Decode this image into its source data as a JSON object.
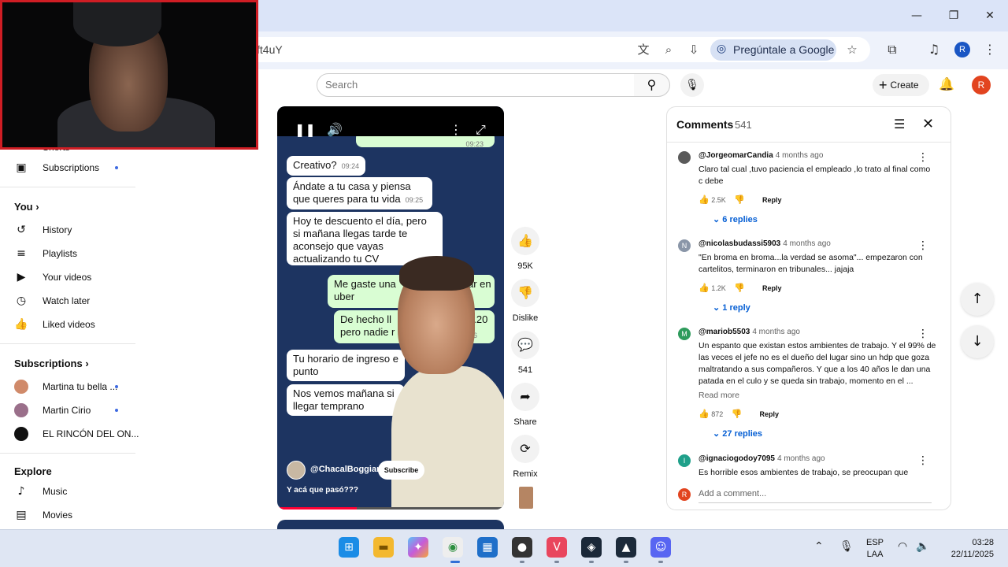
{
  "window": {
    "minimize": "—",
    "maximize": "❐",
    "close": "✕"
  },
  "browser": {
    "url_fragment": "ft4uY",
    "google_pill": "Pregúntale a Google",
    "profile_initial": "R"
  },
  "youtube": {
    "search_placeholder": "Search",
    "create_label": "Create",
    "avatar_initial": "R"
  },
  "sidebar": {
    "shorts": "Shorts",
    "subscriptions_item": "Subscriptions",
    "you_heading": "You",
    "you_items": [
      "History",
      "Playlists",
      "Your videos",
      "Watch later",
      "Liked videos"
    ],
    "subscriptions_heading": "Subscriptions",
    "channels": [
      "Martina tu bella ...",
      "Martin Cirio",
      "EL RINCÓN DEL ON..."
    ],
    "explore_heading": "Explore",
    "explore_items": [
      "Music",
      "Movies"
    ]
  },
  "video": {
    "chat": [
      {
        "text": "Creativo?",
        "time": "09:24"
      },
      {
        "text": "Ándate a tu casa y piensa que queres para tu vida",
        "time": "09:25"
      },
      {
        "text": "Hoy te descuento el día, pero si mañana llegas tarde te aconsejo que vayas actualizando tu CV",
        "time": "09:25"
      },
      {
        "text": "Me gaste una",
        "time": ""
      },
      {
        "text": "uber",
        "time": "26"
      },
      {
        "text": "De hecho ll",
        "time": ""
      },
      {
        "text": "pero nadie r",
        "time": ""
      },
      {
        "text": "Tu horario de ingreso e",
        "time": ""
      },
      {
        "text": "punto",
        "time": ""
      },
      {
        "text": "Nos vemos mañana si",
        "time": ""
      },
      {
        "text": "llegar temprano",
        "time": ""
      },
      {
        "text": "ar en",
        "time": ""
      },
      {
        "text": "9.20",
        "time": ""
      },
      {
        "text": "26",
        "time": ""
      },
      {
        "text": "09:23",
        "time": ""
      }
    ],
    "channel": "@ChacalBoggian",
    "subscribe": "Subscribe",
    "caption": "Y acá que pasó???",
    "progress": 0.35
  },
  "actions": {
    "likes": "95K",
    "dislike": "Dislike",
    "comments": "541",
    "share": "Share",
    "remix": "Remix"
  },
  "comments": {
    "title": "Comments",
    "count": "541",
    "items": [
      {
        "user": "@JorgeomarCandia",
        "time": "4 months ago",
        "text": "Claro tal cual ,tuvo paciencia el empleado ,lo trato al final como c debe",
        "likes": "2.5K",
        "reply": "Reply",
        "replies": "6 replies",
        "avatar_color": "#5a5a5a",
        "initial": ""
      },
      {
        "user": "@nicolasbudassi5903",
        "time": "4 months ago",
        "text": "\"En broma en broma...la verdad se asoma\"... empezaron con cartelitos, terminaron en tribunales... jajaja",
        "likes": "1.2K",
        "reply": "Reply",
        "replies": "1 reply",
        "avatar_color": "#8a96a8",
        "initial": "N"
      },
      {
        "user": "@mariob5503",
        "time": "4 months ago",
        "text": "Un espanto que existan estos ambientes de trabajo.  Y el 99% de las veces el jefe no es el dueño del lugar sino un hdp que goza maltratando a sus compañeros. Y que a los 40 años le dan una patada en el culo y se queda sin trabajo, momento en el ...",
        "read_more": "Read more",
        "likes": "872",
        "reply": "Reply",
        "replies": "27 replies",
        "avatar_color": "#2e9b5c",
        "initial": "M"
      },
      {
        "user": "@ignaciogodoy7095",
        "time": "4 months ago",
        "text": "Es horrible esos ambientes de trabajo, se preocupan que",
        "avatar_color": "#1fa08a",
        "initial": "I"
      }
    ],
    "add_placeholder": "Add a comment...",
    "add_initial": "R"
  },
  "taskbar": {
    "lang_top": "ESP",
    "lang_bottom": "LAA",
    "time": "03:28",
    "date": "22/11/2025"
  }
}
